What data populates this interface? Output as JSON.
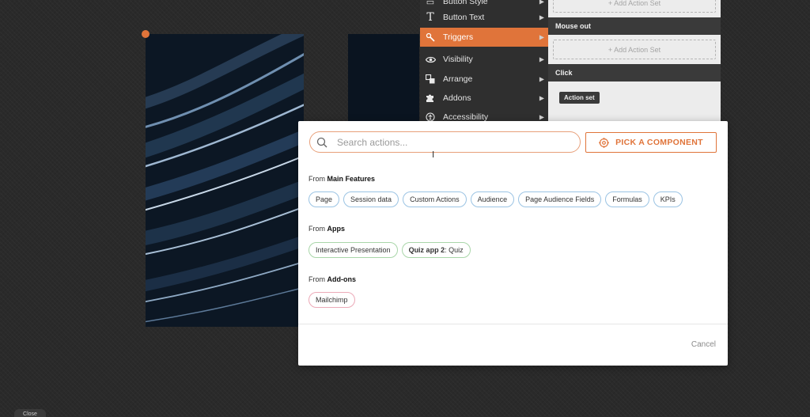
{
  "context_menu": {
    "items": [
      {
        "label": "Button Style",
        "icon": "button-style-icon",
        "active": false
      },
      {
        "label": "Button Text",
        "icon": "text-icon",
        "active": false
      },
      {
        "label": "Triggers",
        "icon": "wand-icon",
        "active": true
      },
      {
        "label": "Visibility",
        "icon": "eye-icon",
        "active": false
      },
      {
        "label": "Arrange",
        "icon": "arrange-icon",
        "active": false
      },
      {
        "label": "Addons",
        "icon": "puzzle-icon",
        "active": false
      },
      {
        "label": "Accessibility",
        "icon": "accessibility-icon",
        "active": false
      }
    ]
  },
  "action_panel": {
    "add_action_set_top": "+ Add Action Set",
    "mouse_out_header": "Mouse out",
    "add_action_set_mouse_out": "+ Add Action Set",
    "click_header": "Click",
    "action_set_tag": "Action set"
  },
  "modal": {
    "search_placeholder": "Search actions...",
    "pick_component_label": "PICK A COMPONENT",
    "sections": {
      "main": {
        "prefix": "From",
        "name": "Main Features",
        "chips": [
          "Page",
          "Session data",
          "Custom Actions",
          "Audience",
          "Page Audience Fields",
          "Formulas",
          "KPIs"
        ]
      },
      "apps": {
        "prefix": "From",
        "name": "Apps",
        "chip_1": "Interactive Presentation",
        "chip_2_bold": "Quiz app 2",
        "chip_2_rest": ": Quiz"
      },
      "addons": {
        "prefix": "From",
        "name": "Add-ons",
        "chips": [
          "Mailchimp"
        ]
      }
    },
    "cancel_label": "Cancel"
  },
  "bottom_tab_label": "Close",
  "colors": {
    "accent": "#e0743a",
    "chip_blue": "#9cc4e4",
    "chip_green": "#a9d6a9",
    "chip_pink": "#ecaab8"
  }
}
